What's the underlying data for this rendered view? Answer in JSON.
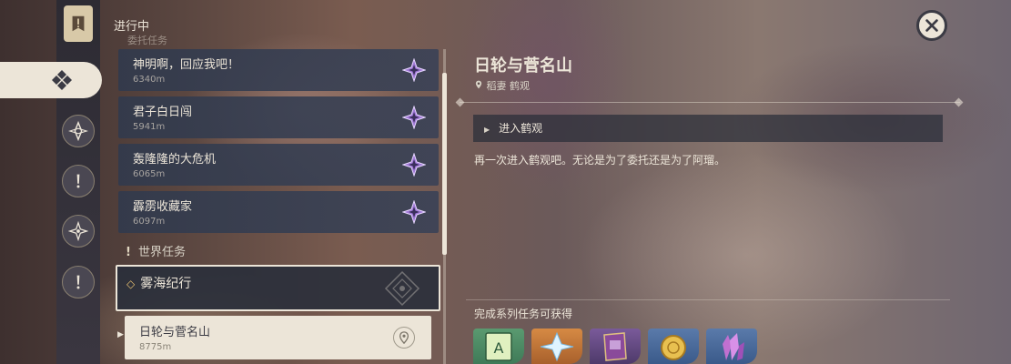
{
  "header": {
    "section_title": "进行中",
    "faded_category": "委托任务"
  },
  "quests": [
    {
      "name": "神明啊，回应我吧！",
      "distance": "6340m"
    },
    {
      "name": "君子白日闯",
      "distance": "5941m"
    },
    {
      "name": "轰隆隆的大危机",
      "distance": "6065m"
    },
    {
      "name": "霹雳收藏家",
      "distance": "6097m"
    }
  ],
  "world_quests": {
    "label": "世界任务",
    "chapter": "雾海纪行",
    "sub_quest": {
      "name": "日轮与菅名山",
      "distance": "8775m"
    }
  },
  "detail": {
    "title": "日轮与菅名山",
    "location": "稻妻 鹤观",
    "objective": "进入鹤观",
    "description": "再一次进入鹤观吧。无论是为了委托还是为了阿瑠。",
    "rewards_label": "完成系列任务可获得",
    "rewards": [
      {
        "icon": "talent-book-icon",
        "color": "#4e9a6a"
      },
      {
        "icon": "primogem-icon",
        "color": "#c8793a"
      },
      {
        "icon": "hero-wit-book-icon",
        "color": "#6a4c8a"
      },
      {
        "icon": "mora-icon",
        "color": "#4b6a9a"
      },
      {
        "icon": "crystal-icon",
        "color": "#4b6a9a"
      }
    ]
  },
  "colors": {
    "accent_cream": "#ece5d8",
    "quest_star": "#a27ad8",
    "panel_dark": "#323a4c"
  }
}
